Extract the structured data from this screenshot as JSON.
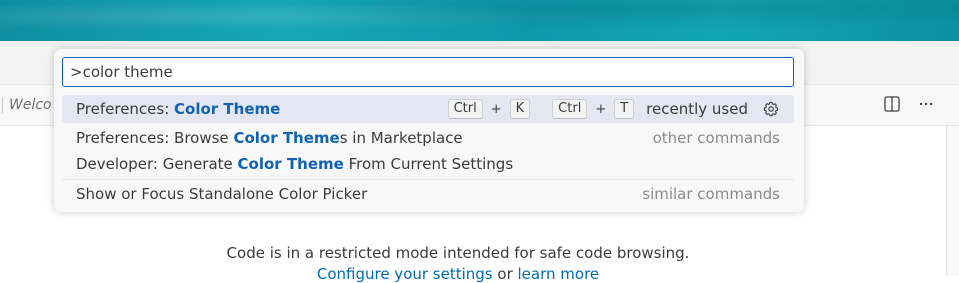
{
  "command_palette": {
    "input_value": ">color theme",
    "items": [
      {
        "prefix": "Preferences: ",
        "highlight": "Color Theme",
        "suffix": "",
        "keybinding_1": [
          "Ctrl",
          "+",
          "K"
        ],
        "keybinding_2": [
          "Ctrl",
          "+",
          "T"
        ],
        "category": "recently used"
      },
      {
        "prefix": "Preferences: Browse ",
        "highlight": "Color Theme",
        "suffix": "s in Marketplace",
        "category": "other commands"
      },
      {
        "prefix": "Developer: Generate ",
        "highlight": "Color Theme",
        "suffix": " From Current Settings",
        "category": ""
      },
      {
        "prefix": "Show or Focus Standalone Color Picker",
        "highlight": "",
        "suffix": "",
        "category": "similar commands"
      }
    ]
  },
  "editor": {
    "tab_label": "Welco",
    "restricted_message": "Code is in a restricted mode intended for safe code browsing.",
    "configure_link": "Configure your settings",
    "or_text": " or ",
    "learn_more_link": "learn more"
  },
  "icons": {
    "split_editor": "split-editor-icon",
    "more_actions": "more-actions-icon",
    "gear": "gear-icon"
  },
  "colors": {
    "accent": "#005fb8",
    "highlight_text": "#0f62b4",
    "selected_row": "#e4e6f1"
  }
}
